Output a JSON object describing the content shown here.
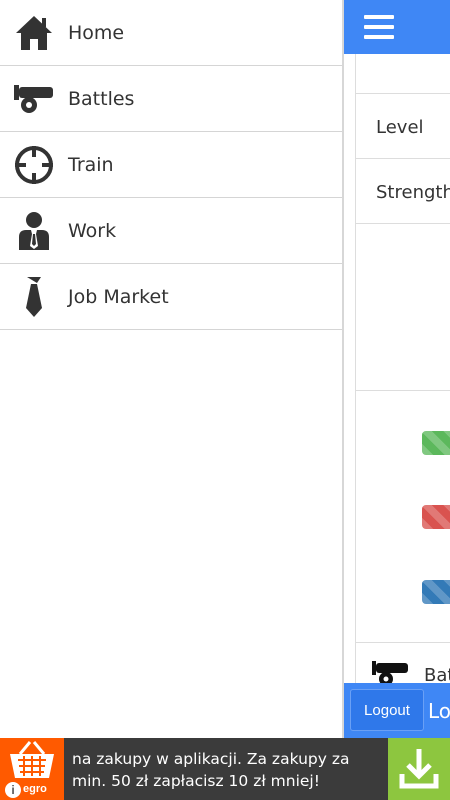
{
  "drawer": {
    "items": [
      {
        "label": "Home",
        "icon": "home-icon"
      },
      {
        "label": "Battles",
        "icon": "cannon-icon"
      },
      {
        "label": "Train",
        "icon": "crosshair-icon"
      },
      {
        "label": "Work",
        "icon": "worker-icon"
      },
      {
        "label": "Job Market",
        "icon": "tie-icon"
      }
    ]
  },
  "main": {
    "rows": {
      "level_label": "Level",
      "strength_label": "Strength"
    },
    "bars": [
      {
        "color": "#5cb85c"
      },
      {
        "color": "#d9534f"
      },
      {
        "color": "#337ab7"
      }
    ],
    "battles_peek": "Bat",
    "logout_label": "Logout",
    "logout_peek": "Lo"
  },
  "ad": {
    "text": "na zakupy w aplikacji. Za zakupy za min. 50 zł zapłacisz 10 zł mniej!",
    "brand_fragment": "egro",
    "info_symbol": "i"
  },
  "colors": {
    "header_blue": "#3f87f5",
    "ad_orange": "#ff5a00",
    "ad_green": "#8dc63f",
    "icon_dark": "#333333"
  }
}
